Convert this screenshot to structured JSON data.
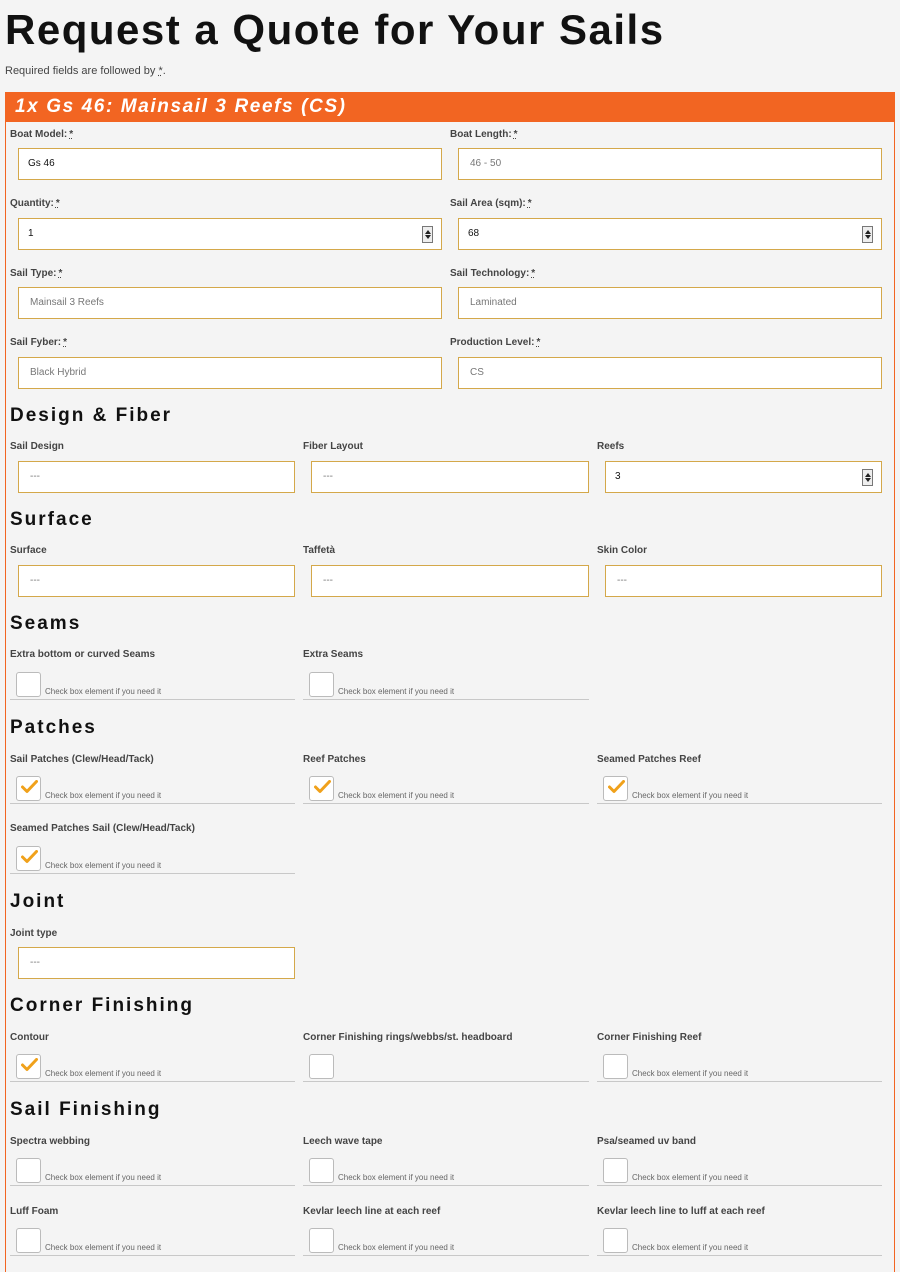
{
  "page": {
    "title": "Request a Quote for Your Sails",
    "required_note": "Required fields are followed by",
    "required_star": "*",
    "required_period": "."
  },
  "panel": {
    "header": "1x Gs 46: Mainsail 3 Reefs (CS)"
  },
  "required_marker": "*",
  "fields": {
    "boat_model": {
      "label": "Boat Model:",
      "value": "Gs 46"
    },
    "boat_length": {
      "label": "Boat Length:",
      "value": "46 - 50"
    },
    "quantity": {
      "label": "Quantity:",
      "value": "1"
    },
    "sail_area": {
      "label": "Sail Area (sqm):",
      "value": "68"
    },
    "sail_type": {
      "label": "Sail Type:",
      "value": "Mainsail 3 Reefs"
    },
    "sail_technology": {
      "label": "Sail Technology:",
      "value": "Laminated"
    },
    "sail_fyber": {
      "label": "Sail Fyber:",
      "value": "Black Hybrid"
    },
    "production_level": {
      "label": "Production Level:",
      "value": "CS"
    }
  },
  "sections": {
    "design_fiber": {
      "title": "Design & Fiber",
      "sail_design": {
        "label": "Sail Design",
        "value": "---"
      },
      "fiber_layout": {
        "label": "Fiber Layout",
        "value": "---"
      },
      "reefs": {
        "label": "Reefs",
        "value": "3"
      }
    },
    "surface": {
      "title": "Surface",
      "surface": {
        "label": "Surface",
        "value": "---"
      },
      "taffeta": {
        "label": "Taffetà",
        "value": "---"
      },
      "skin_color": {
        "label": "Skin Color",
        "value": "---"
      }
    },
    "seams": {
      "title": "Seams",
      "extra_bottom": {
        "label": "Extra bottom or curved Seams",
        "checked": false
      },
      "extra_seams": {
        "label": "Extra Seams",
        "checked": false
      }
    },
    "patches": {
      "title": "Patches",
      "sail_patches": {
        "label": "Sail Patches (Clew/Head/Tack)",
        "checked": true
      },
      "reef_patches": {
        "label": "Reef Patches",
        "checked": true
      },
      "seamed_patches_reef": {
        "label": "Seamed Patches Reef",
        "checked": true
      },
      "seamed_patches_sail": {
        "label": "Seamed Patches Sail (Clew/Head/Tack)",
        "checked": true
      }
    },
    "joint": {
      "title": "Joint",
      "joint_type": {
        "label": "Joint type",
        "value": "---"
      }
    },
    "corner_finishing": {
      "title": "Corner Finishing",
      "contour": {
        "label": "Contour",
        "checked": true
      },
      "rings": {
        "label": "Corner Finishing rings/webbs/st. headboard",
        "checked": false
      },
      "reef": {
        "label": "Corner Finishing Reef",
        "checked": false
      }
    },
    "sail_finishing": {
      "title": "Sail Finishing",
      "spectra": {
        "label": "Spectra webbing",
        "checked": false
      },
      "leech_wave": {
        "label": "Leech wave tape",
        "checked": false
      },
      "psa": {
        "label": "Psa/seamed uv band",
        "checked": false
      },
      "luff_foam": {
        "label": "Luff Foam",
        "checked": false
      },
      "kevlar_leech": {
        "label": "Kevlar leech line at each reef",
        "checked": false
      },
      "kevlar_luff": {
        "label": "Kevlar leech line to luff at each reef",
        "checked": false
      }
    }
  },
  "check_hint": "Check box element if you need it",
  "icons": {
    "checkmark": "checkmark-icon",
    "spinner": "number-spinner"
  },
  "colors": {
    "accent": "#f26522",
    "field_border": "#d4a84a",
    "check": "#f0a11b"
  }
}
